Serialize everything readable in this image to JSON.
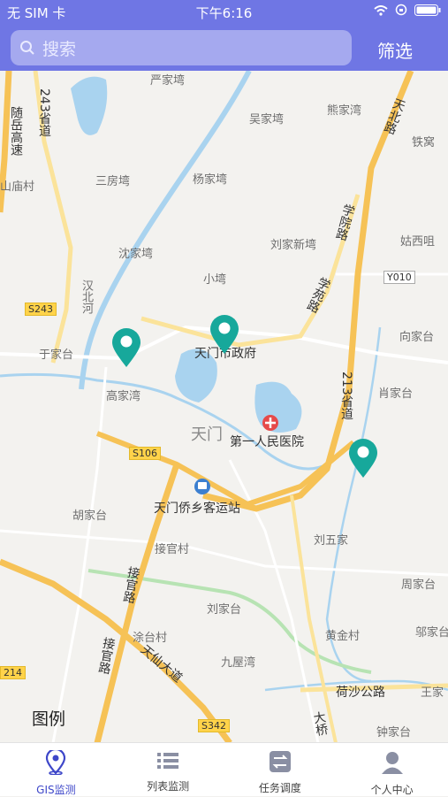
{
  "status": {
    "carrier": "无 SIM 卡",
    "time": "下午6:16"
  },
  "header": {
    "search_placeholder": "搜索",
    "filter_label": "筛选"
  },
  "map": {
    "labels": {
      "yanjiawan": "严家塆",
      "wujiawan": "吴家塆",
      "xiongjiawan": "熊家湾",
      "tiewo": "铁窝",
      "sanfangwan": "三房塆",
      "yangjiawan": "杨家塆",
      "shanmiaocun": "山庙村",
      "liujiaxinwan": "刘家新塆",
      "guxiju": "姑西咀",
      "shenjiawan": "沈家塆",
      "xiaowan": "小塆",
      "hanbeihe": "汉北河",
      "yujiatai": "于家台",
      "xiangjiatai": "向家台",
      "gaojiawan": "高家湾",
      "tianmenfu": "天门市政府",
      "xiaojiatai": "肖家台",
      "tianmen": "天门",
      "hospital": "第一人民医院",
      "busstation": "天门侨乡客运站",
      "hujiatai": "胡家台",
      "jieguancun": "接官村",
      "liuwujia": "刘五家",
      "zhoujiatai": "周家台",
      "liujiatai": "刘家台",
      "tutaicun": "涂台村",
      "huangjincun": "黄金村",
      "wujiatai2": "邬家台",
      "jiuwuwan": "九屋湾",
      "heshagonglu": "荷沙公路",
      "wangjia": "王家",
      "zhongjiatai": "钟家台",
      "sui_yue": "随岳高速",
      "sheng243": "243省道",
      "tianbeilu": "天北路",
      "xueyuanlu": "学院路",
      "xueyuanlu2": "学苑路",
      "sheng213": "213省道",
      "jieguanlu": "接官路",
      "jieguanlu2": "接官路",
      "tianxiandadao": "天仙大道",
      "daqiao": "大桥",
      "s243": "S243",
      "s106": "S106",
      "s342": "S342",
      "y010": "Y010",
      "s214": "214"
    }
  },
  "legend_label": "图例",
  "tabs": [
    {
      "label": "GIS监测"
    },
    {
      "label": "列表监测"
    },
    {
      "label": "任务调度"
    },
    {
      "label": "个人中心"
    }
  ],
  "colors": {
    "accent": "#6f76e4",
    "marker": "#17a89b",
    "tab_active": "#3e47c9"
  }
}
